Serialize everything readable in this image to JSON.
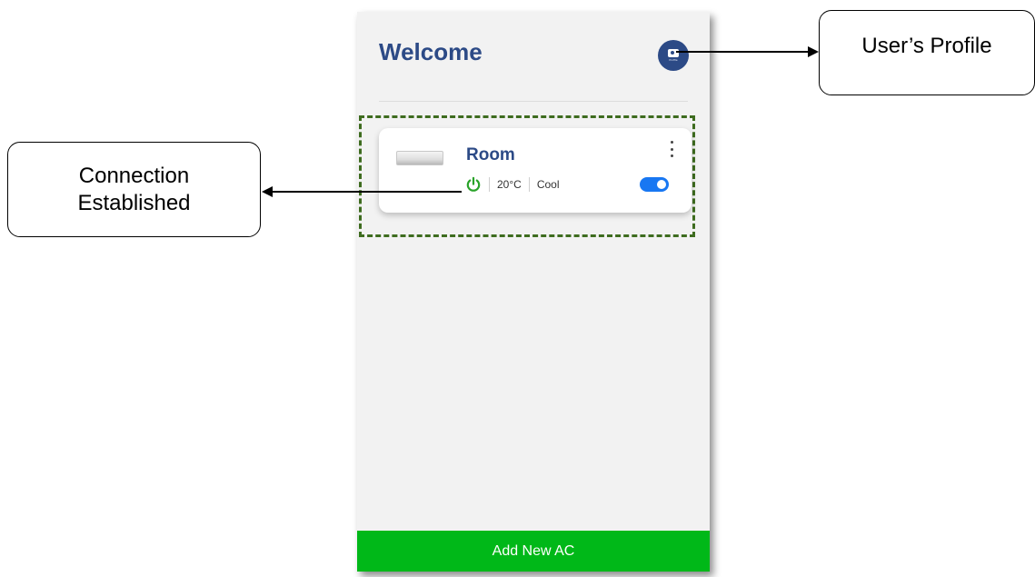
{
  "app": {
    "title": "Welcome",
    "profile_avatar_caption": "Profile"
  },
  "devices": [
    {
      "name": "Room",
      "temperature": "20°C",
      "mode": "Cool",
      "power_on": true,
      "switch_on": true
    }
  ],
  "footer": {
    "add_button_label": "Add New AC"
  },
  "annotations": {
    "profile_label": "User’s Profile",
    "connection_label_line1": "Connection",
    "connection_label_line2": "Established"
  },
  "colors": {
    "brand_blue": "#2c4a86",
    "power_green": "#29a329",
    "toggle_blue": "#1877f2",
    "button_green": "#00b818",
    "highlight_border": "#3e6c1f"
  },
  "icons": [
    "user-profile-icon",
    "ac-unit-icon",
    "more-vertical-icon",
    "power-icon",
    "toggle-switch"
  ]
}
